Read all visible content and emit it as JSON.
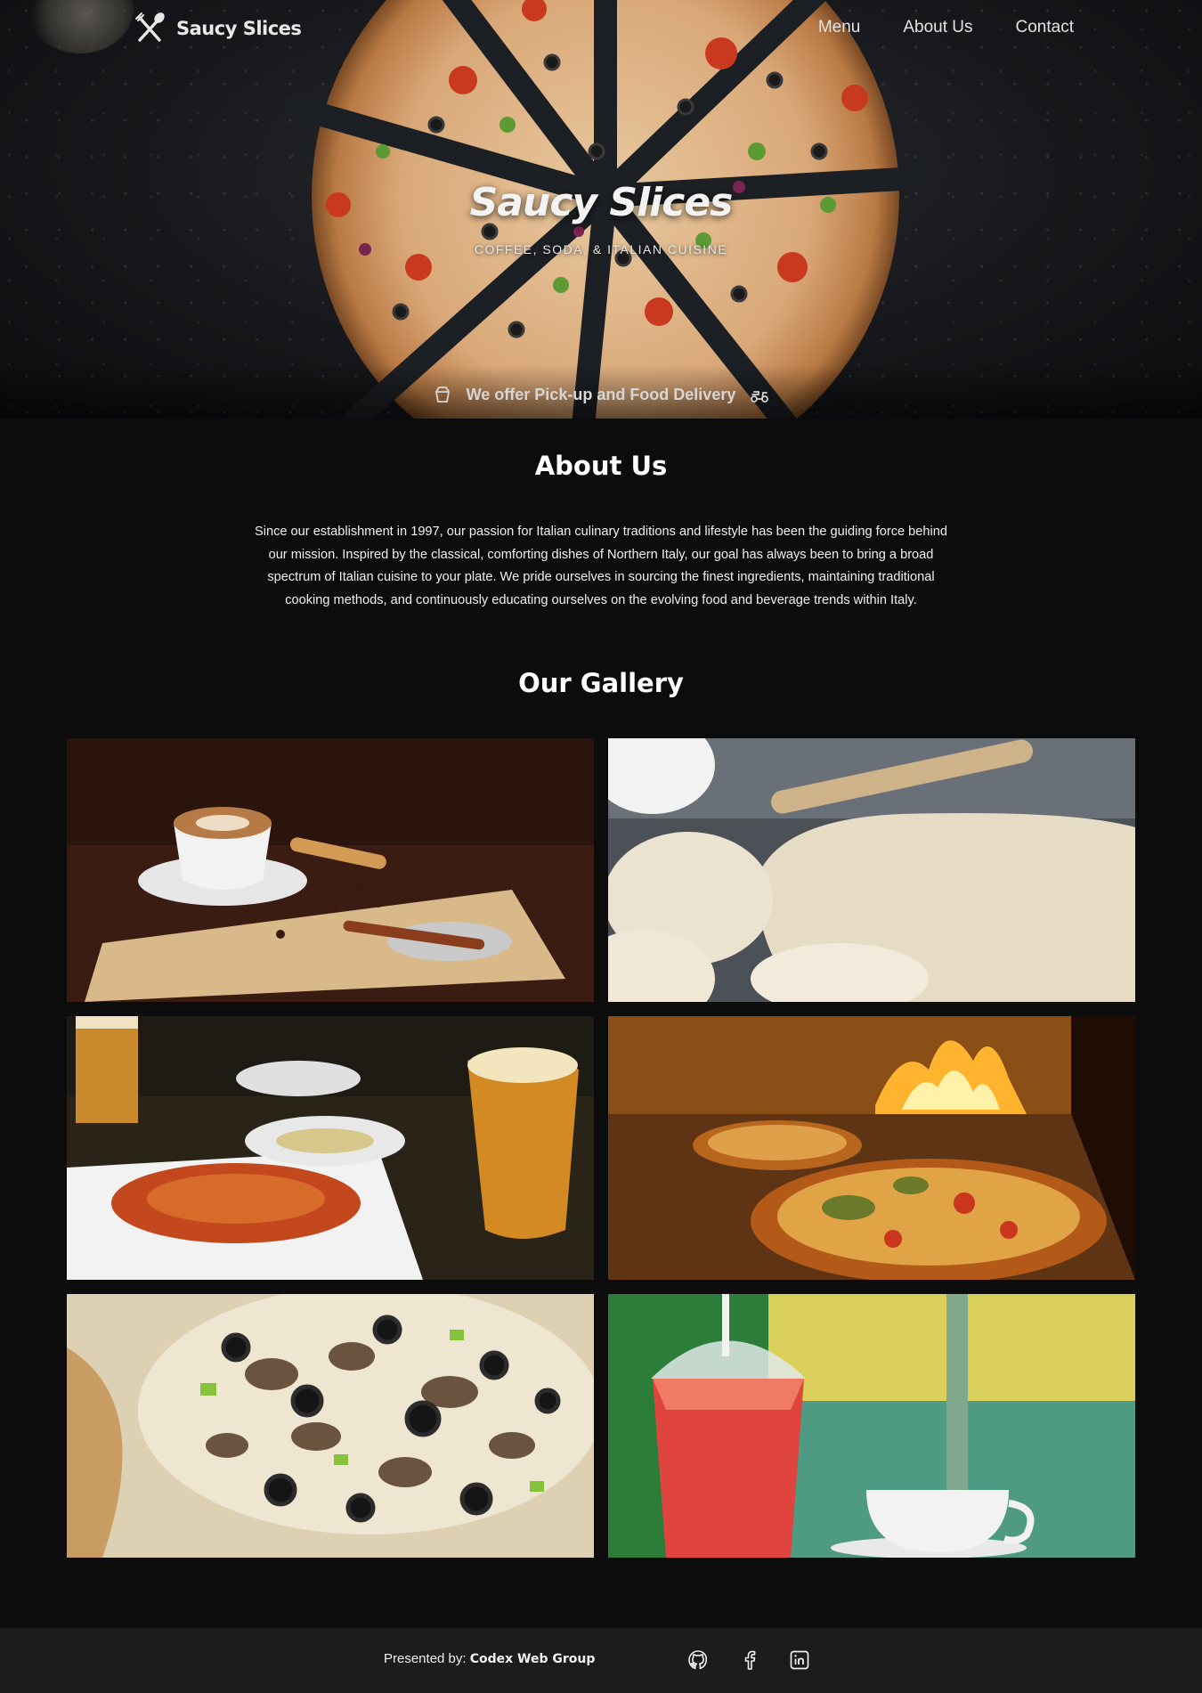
{
  "nav": {
    "brand": "Saucy Slices",
    "links": [
      "Menu",
      "About Us",
      "Contact"
    ]
  },
  "hero": {
    "title": "Saucy Slices",
    "subtitle": "COFFEE, SODA, & ITALIAN CUISINE",
    "delivery": "We offer Pick-up and Food Delivery",
    "icons": [
      "takeout-box-icon",
      "delivery-scooter-icon"
    ]
  },
  "about": {
    "title": "About Us",
    "text": "Since our establishment in 1997, our passion for Italian culinary traditions and lifestyle has been the guiding force behind our mission. Inspired by the classical, comforting dishes of Northern Italy, our goal has always been to bring a broad spectrum of Italian cuisine to your plate. We pride ourselves in sourcing the finest ingredients, maintaining traditional cooking methods, and continuously educating ourselves on the evolving food and beverage trends within Italy."
  },
  "gallery": {
    "title": "Our Gallery",
    "images": [
      "coffee-cannoli-photo",
      "pizza-dough-photo",
      "spaghetti-beer-photo",
      "wood-oven-pizza-photo",
      "mushroom-olive-pizza-photo",
      "red-soda-coffee-photo"
    ]
  },
  "footer": {
    "presented_label": "Presented by:",
    "presented_by": "Codex Web Group",
    "social": [
      "github-icon",
      "facebook-icon",
      "linkedin-icon"
    ]
  },
  "colors": {
    "background": "#0c0c0c",
    "footer": "#1c1c1c",
    "text": "#ffffff"
  }
}
